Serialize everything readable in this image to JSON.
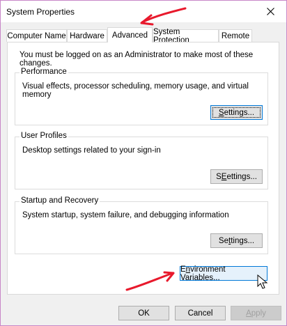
{
  "window": {
    "title": "System Properties"
  },
  "tabs": [
    {
      "label": "Computer Name"
    },
    {
      "label": "Hardware"
    },
    {
      "label": "Advanced"
    },
    {
      "label": "System Protection"
    },
    {
      "label": "Remote"
    }
  ],
  "active_tab": "Advanced",
  "admin_note": "You must be logged on as an Administrator to make most of these changes.",
  "groups": {
    "performance": {
      "title": "Performance",
      "description": "Visual effects, processor scheduling, memory usage, and virtual memory",
      "button_accel": "S",
      "button_rest": "ettings..."
    },
    "user_profiles": {
      "title": "User Profiles",
      "description": "Desktop settings related to your sign-in",
      "button_accel": "E",
      "button_rest": "ettings...",
      "button_prefix": "S"
    },
    "startup_recovery": {
      "title": "Startup and Recovery",
      "description": "System startup, system failure, and debugging information",
      "button_prefix": "Se",
      "button_accel": "t",
      "button_rest": "tings..."
    }
  },
  "env_button": {
    "prefix": "E",
    "accel": "n",
    "rest": "vironment Variables..."
  },
  "footer": {
    "ok_label": "OK",
    "cancel_label": "Cancel",
    "apply_accel": "A",
    "apply_rest": "pply"
  },
  "colors": {
    "annotation_arrow": "#e8192c",
    "focus_border": "#0078d7"
  },
  "icons": {
    "close": "close-icon",
    "arrow": "red-arrow-annotation",
    "cursor": "mouse-pointer-icon"
  }
}
